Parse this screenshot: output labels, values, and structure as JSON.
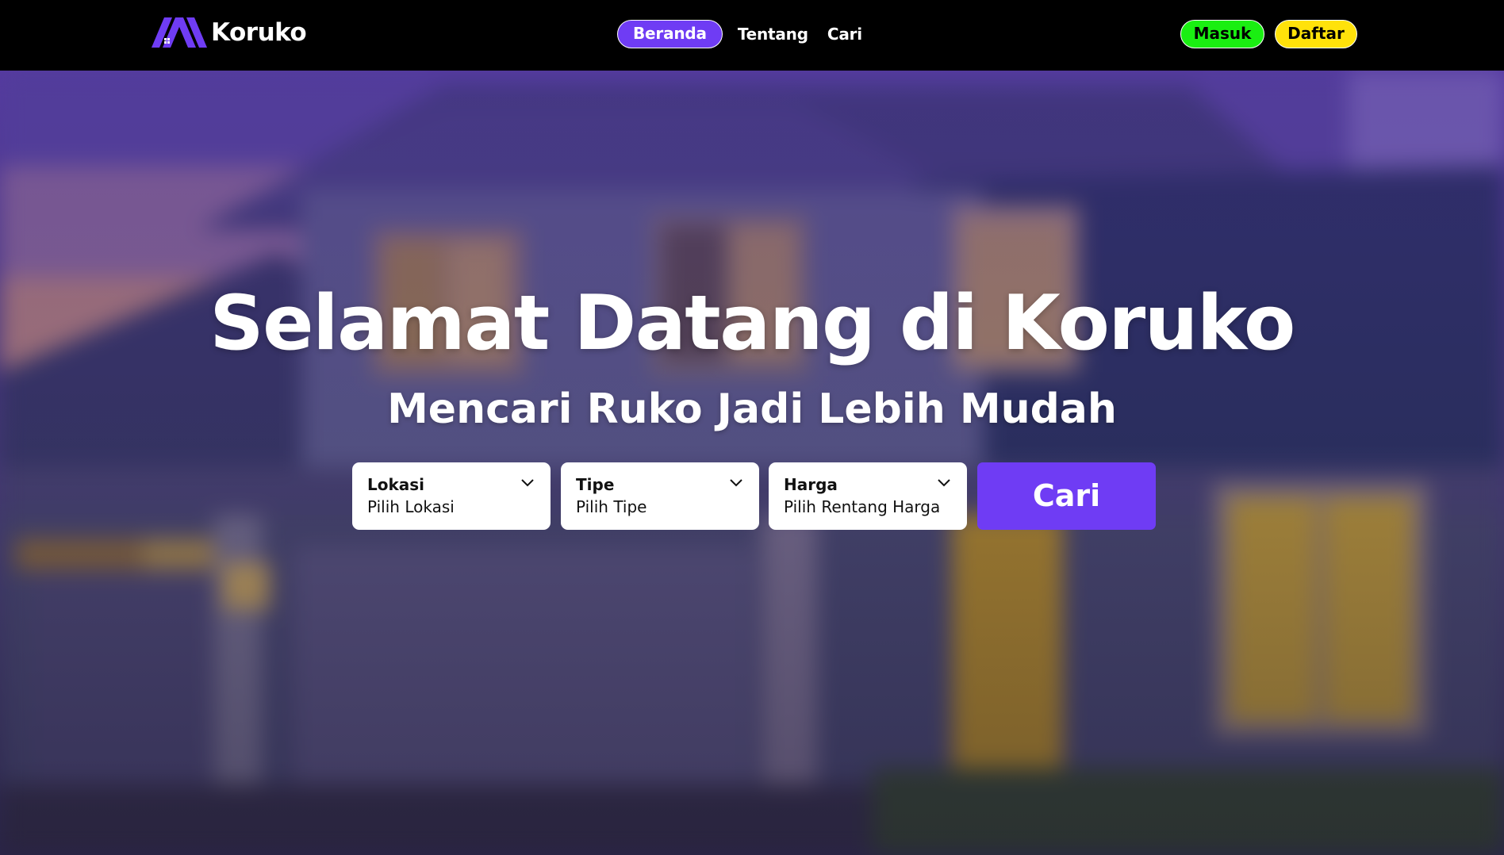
{
  "navbar": {
    "brand": "Koruko",
    "links": [
      {
        "label": "Beranda",
        "active": true
      },
      {
        "label": "Tentang",
        "active": false
      },
      {
        "label": "Cari",
        "active": false
      }
    ],
    "login_label": "Masuk",
    "register_label": "Daftar"
  },
  "hero": {
    "title": "Selamat Datang di Koruko",
    "subtitle": "Mencari Ruko Jadi Lebih Mudah"
  },
  "search": {
    "location": {
      "label": "Lokasi",
      "value": "Pilih Lokasi"
    },
    "type": {
      "label": "Tipe",
      "value": "Pilih Tipe"
    },
    "price": {
      "label": "Harga",
      "value": "Pilih Rentang Harga"
    },
    "submit_label": "Cari"
  },
  "colors": {
    "accent": "#6f3cf4",
    "login": "#1aef12",
    "register": "#ffe20a",
    "navbar": "#000000"
  },
  "icons": {
    "logo": "koruko-logo-icon",
    "dropdown": "chevron-down-icon"
  }
}
